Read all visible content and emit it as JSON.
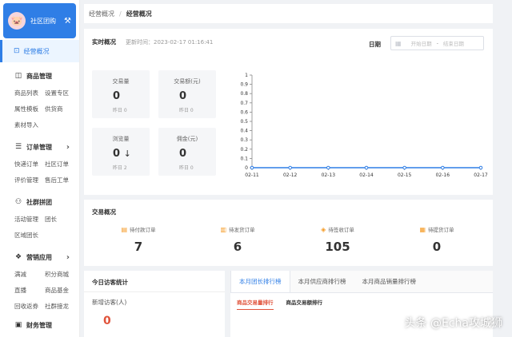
{
  "sidebar": {
    "brand": {
      "name": "社区团购",
      "avatar_icon": "pig-avatar-icon",
      "tool_icon": "tools-icon"
    },
    "active": {
      "label": "经营概况",
      "icon": "chart-icon"
    },
    "groups": [
      {
        "title": "商品管理",
        "icon": "box-icon",
        "items": [
          "商品列表",
          "设置专区",
          "属性模板",
          "供货商",
          "素材导入"
        ]
      },
      {
        "title": "订单管理",
        "icon": "order-icon",
        "has_arrow": true,
        "items": [
          "快递订单",
          "社区订单",
          "评价管理",
          "售后工单"
        ]
      },
      {
        "title": "社群拼团",
        "icon": "group-icon",
        "items": [
          "活动管理",
          "团长",
          "区域团长"
        ]
      },
      {
        "title": "营销应用",
        "icon": "app-icon",
        "has_arrow": true,
        "items": [
          "满减",
          "积分商城",
          "直播",
          "商品基金",
          "回收返券",
          "社群接龙"
        ]
      },
      {
        "title": "财务管理",
        "icon": "finance-icon",
        "items": []
      }
    ]
  },
  "breadcrumb": {
    "parent": "经营概况",
    "separator": "/",
    "current": "经营概况"
  },
  "realtime": {
    "title": "实时概况",
    "updated_label": "更新时间：",
    "updated_time": "2023-02-17 01:16:41",
    "date_label": "日期",
    "date_start_placeholder": "开始日期",
    "date_end_placeholder": "结束日期",
    "date_separator": "-",
    "cards": [
      {
        "label": "交易量",
        "value": "0",
        "sub": "昨日 0"
      },
      {
        "label": "交易额(元)",
        "value": "0",
        "sub": "昨日 0"
      },
      {
        "label": "浏览量",
        "value": "0",
        "sub": "昨日 2",
        "trend": "↓"
      },
      {
        "label": "佣金(元)",
        "value": "0",
        "sub": "昨日 0"
      }
    ]
  },
  "chart_data": {
    "type": "line",
    "x": [
      "02-11",
      "02-12",
      "02-13",
      "02-14",
      "02-15",
      "02-16",
      "02-17"
    ],
    "series": [
      {
        "values": [
          0,
          0,
          0,
          0,
          0,
          0,
          0
        ]
      }
    ],
    "y_ticks": [
      "0",
      "0.1",
      "0.2",
      "0.3",
      "0.4",
      "0.5",
      "0.6",
      "0.7",
      "0.8",
      "0.9",
      "1"
    ],
    "ylim": [
      0,
      1
    ],
    "line_color": "#2f7ee6"
  },
  "trade": {
    "title": "交易概况",
    "items": [
      {
        "label": "待付款订单",
        "value": "7",
        "icon": "wallet-icon"
      },
      {
        "label": "待发货订单",
        "value": "6",
        "icon": "truck-icon"
      },
      {
        "label": "待签收订单",
        "value": "105",
        "icon": "package-icon"
      },
      {
        "label": "待提货订单",
        "value": "0",
        "icon": "pickup-icon"
      }
    ]
  },
  "visitors": {
    "title": "今日访客统计",
    "label": "新增访客(人)",
    "value": "0"
  },
  "rank": {
    "tabs": [
      "本月团长排行榜",
      "本月供应商排行榜",
      "本月商品销量排行榜"
    ],
    "subtabs": [
      "商品交易量排行",
      "商品交易额排行"
    ]
  },
  "watermark": "头条 @Echa攻城狮",
  "colors": {
    "accent": "#2f7ee6",
    "danger": "#e0533b",
    "warning": "#f59a23"
  }
}
